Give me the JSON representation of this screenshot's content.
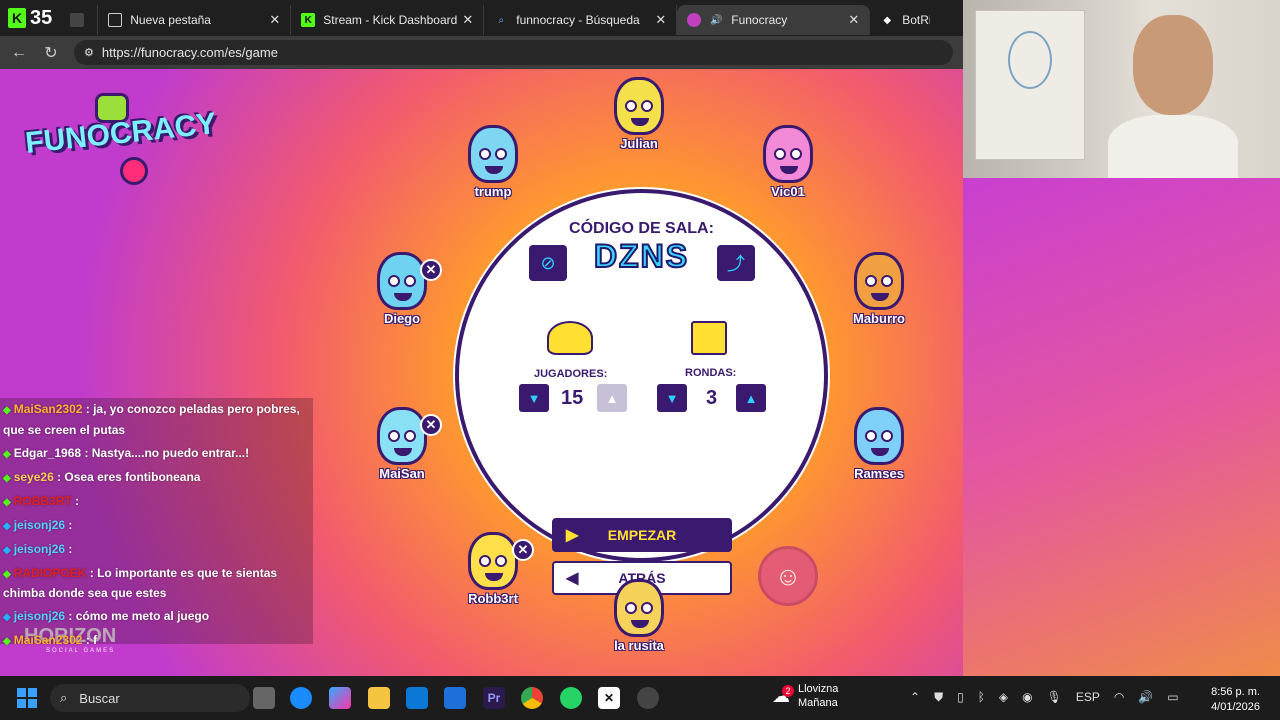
{
  "browser": {
    "tab_count": "35",
    "tabs": [
      {
        "label": "Nueva pestaña",
        "icon": "new-tab-icon"
      },
      {
        "label": "Stream - Kick Dashboard",
        "icon": "kick-icon"
      },
      {
        "label": "funnocracy - Búsqueda",
        "icon": "search-icon"
      },
      {
        "label": "Funocracy",
        "icon": "funocracy-icon"
      },
      {
        "label": "BotRix |",
        "icon": "botrix-icon"
      }
    ],
    "url": "https://funocracy.com/es/game"
  },
  "game": {
    "logo_text": "FUNOCRACY",
    "room_label": "CÓDIGO DE SALA:",
    "room_code": "DZNS",
    "players_label": "JUGADORES:",
    "players_value": "15",
    "rounds_label": "RONDAS:",
    "rounds_value": "3",
    "start_label": "EMPEZAR",
    "back_label": "ATRÁS",
    "publisher": "HORIZON",
    "publisher_sub": "SOCIAL GAMES",
    "players": [
      {
        "name": "Julian",
        "color": "#f4e04a",
        "kickable": false
      },
      {
        "name": "trump",
        "color": "#7fd6f2",
        "kickable": false
      },
      {
        "name": "Vic01",
        "color": "#f28ad8",
        "kickable": false
      },
      {
        "name": "Diego",
        "color": "#6fd2f0",
        "kickable": true
      },
      {
        "name": "Maburro",
        "color": "#f0a040",
        "kickable": false
      },
      {
        "name": "MaiSan",
        "color": "#8ae0f5",
        "kickable": true
      },
      {
        "name": "Ramses",
        "color": "#7fd0f8",
        "kickable": false
      },
      {
        "name": "Robb3rt",
        "color": "#ffe04a",
        "kickable": true
      },
      {
        "name": "la rusita",
        "color": "#f5d35a",
        "kickable": false
      }
    ]
  },
  "chat": [
    {
      "user": "MaiSan2302",
      "color": "#ffb02e",
      "text": ": ja, yo conozco peladas pero pobres, que se creen el putas"
    },
    {
      "user": "Edgar_1968",
      "color": "#ffffff",
      "text": ": Nastya....no puedo entrar...!"
    },
    {
      "user": "seye26",
      "color": "#ffcc55",
      "text": ": Osea eres fontiboneana"
    },
    {
      "user": "ROBB3RT",
      "color": "#e02020",
      "text": ":"
    },
    {
      "user": "jeisonj26",
      "color": "#53d0ff",
      "text": ":"
    },
    {
      "user": "jeisonj26",
      "color": "#53d0ff",
      "text": ":"
    },
    {
      "user": "RADIOPOEK",
      "color": "#e02020",
      "text": ": Lo importante es que te sientas chimba donde sea que estes"
    },
    {
      "user": "jeisonj26",
      "color": "#53d0ff",
      "text": ": cómo me meto al juego"
    },
    {
      "user": "MaiSan2302",
      "color": "#ffb02e",
      "text": ": f"
    }
  ],
  "taskbar": {
    "search_label": "Buscar",
    "weather_title": "Llovizna",
    "weather_sub": "Mañana",
    "weather_badge": "2",
    "lang": "ESP",
    "time": "8:56 p. m.",
    "date": "4/01/2026"
  }
}
